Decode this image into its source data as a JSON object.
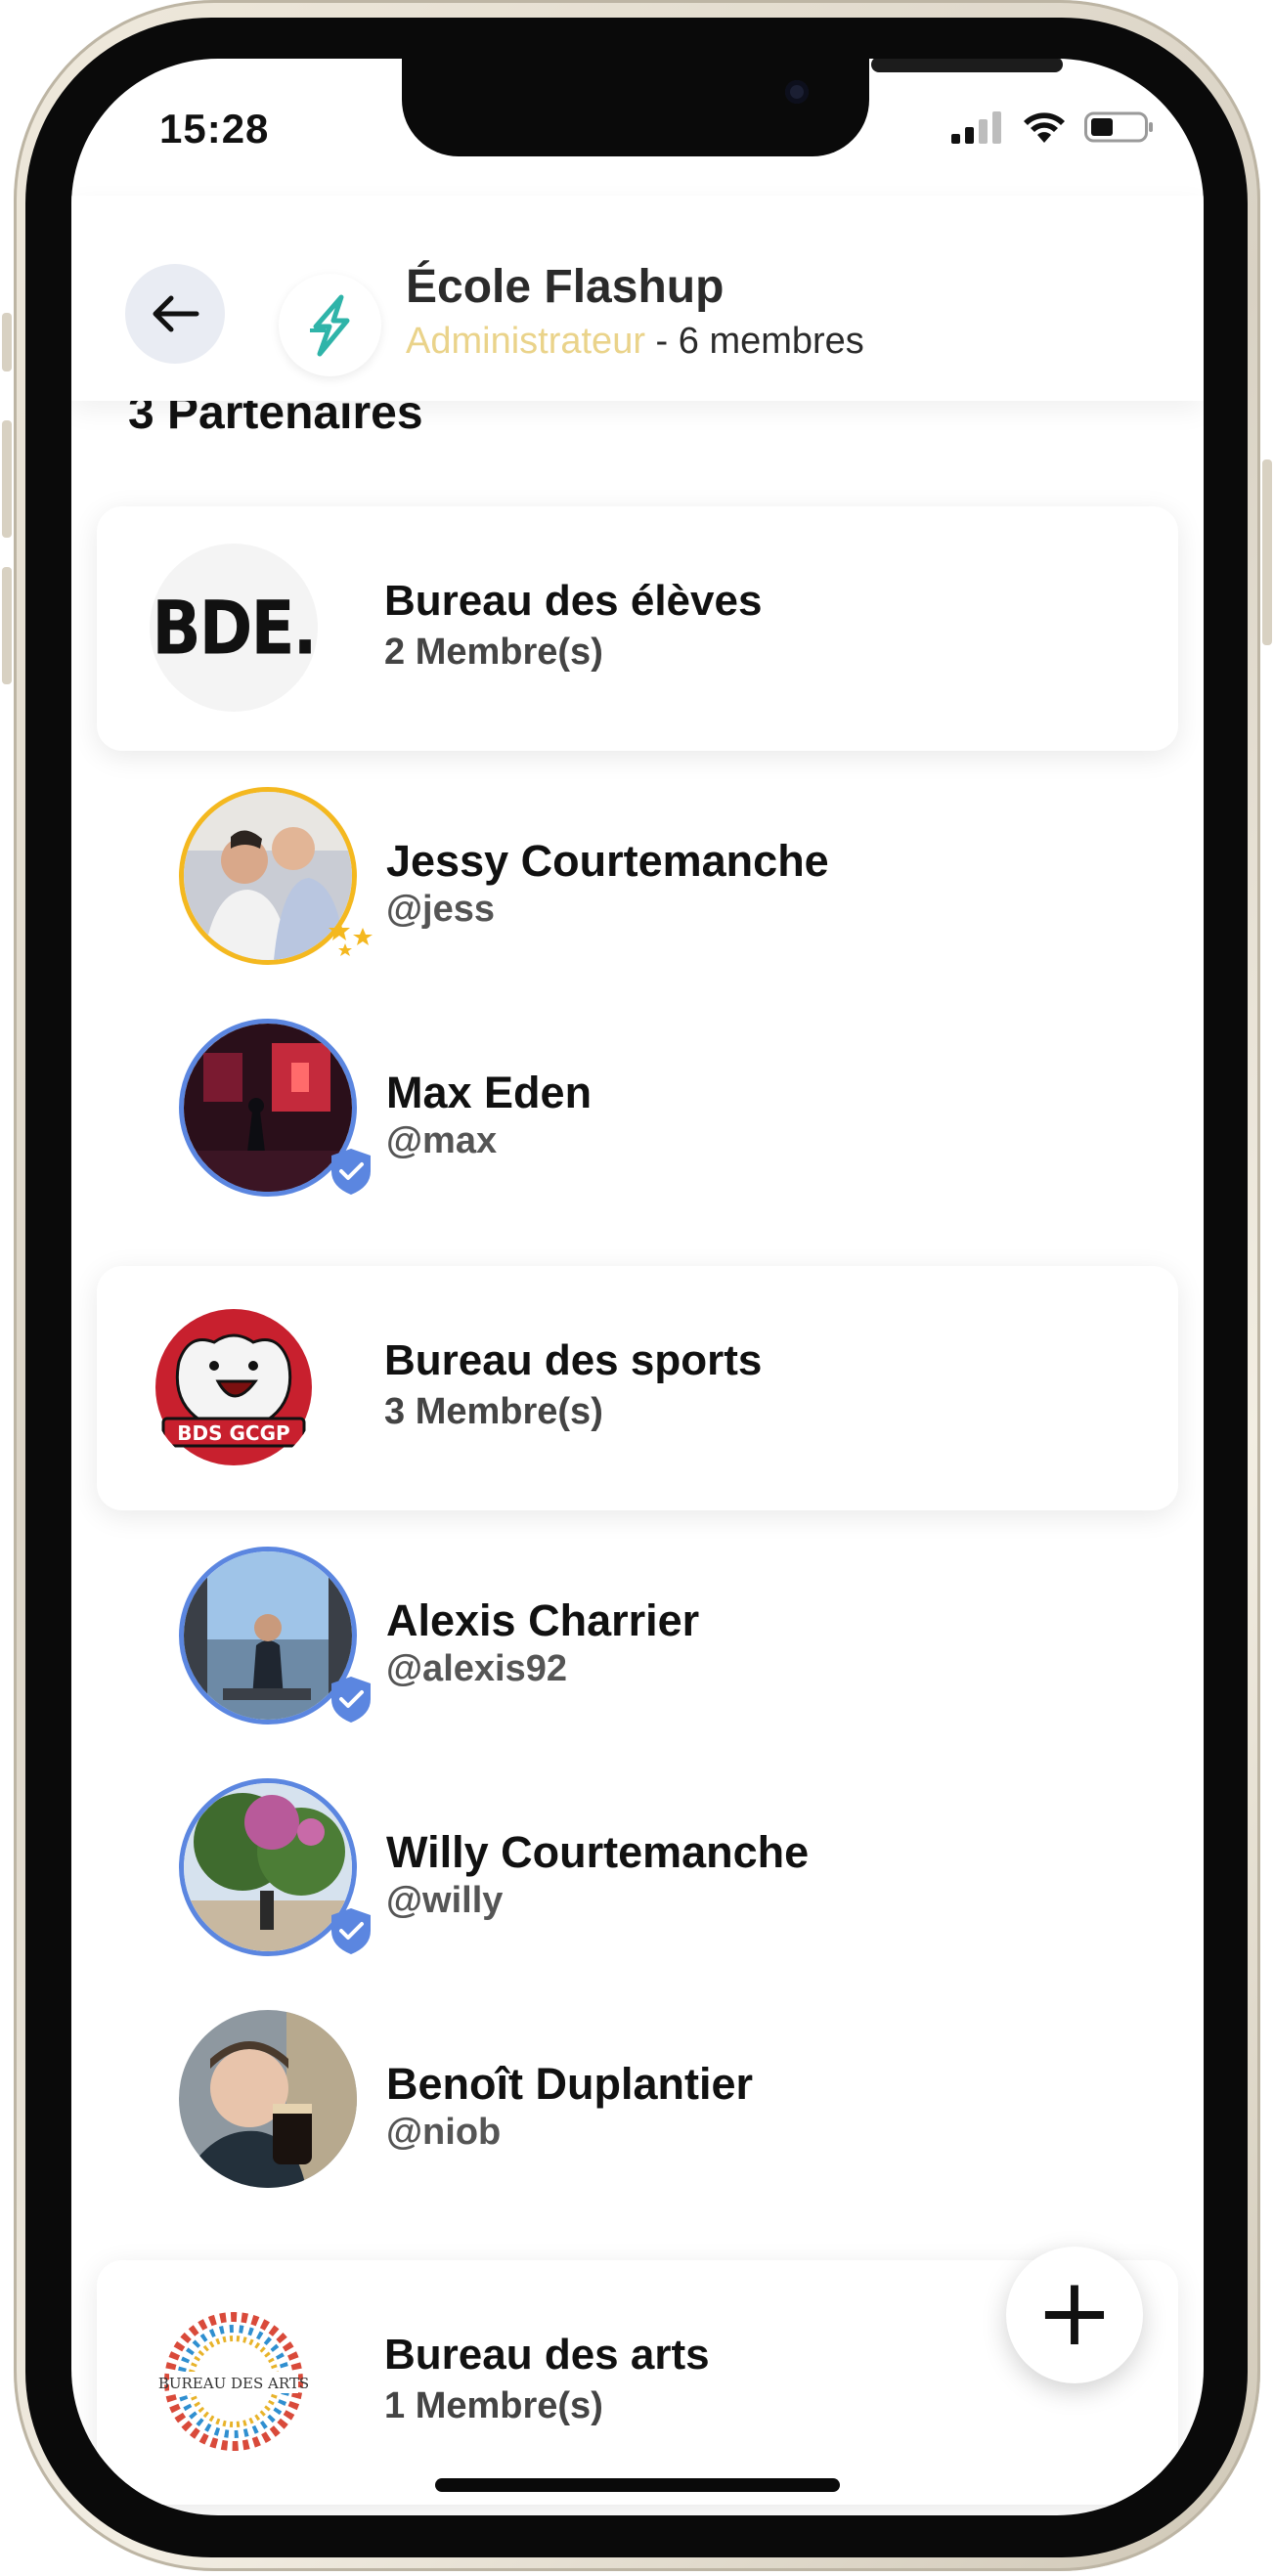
{
  "status_bar": {
    "time": "15:28"
  },
  "header": {
    "group_name": "École Flashup",
    "role": "Administrateur",
    "members_info": " - 6 membres"
  },
  "section_title": "3 Partenaires",
  "groups": [
    {
      "name": "Bureau des élèves",
      "count": "2 Membre(s)",
      "logo_text": "BDE.",
      "members": [
        {
          "name": "Jessy Courtemanche",
          "handle": "@jess",
          "badge": "stars-icon"
        },
        {
          "name": "Max Eden",
          "handle": "@max",
          "badge": "verified-shield-icon"
        }
      ]
    },
    {
      "name": "Bureau des sports",
      "count": "3 Membre(s)",
      "logo_text": "BDS GCGP",
      "members": [
        {
          "name": "Alexis Charrier",
          "handle": "@alexis92",
          "badge": "verified-shield-icon"
        },
        {
          "name": "Willy Courtemanche",
          "handle": "@willy",
          "badge": "verified-shield-icon"
        },
        {
          "name": "Benoît Duplantier",
          "handle": "@niob",
          "badge": ""
        }
      ]
    },
    {
      "name": "Bureau des arts",
      "count": "1 Membre(s)",
      "logo_text": "BUREAU DES ARTS",
      "members": []
    }
  ],
  "fab_label": "+",
  "colors": {
    "role": "#ead38a",
    "verified": "#5b86e0",
    "gold": "#f4b81f"
  }
}
